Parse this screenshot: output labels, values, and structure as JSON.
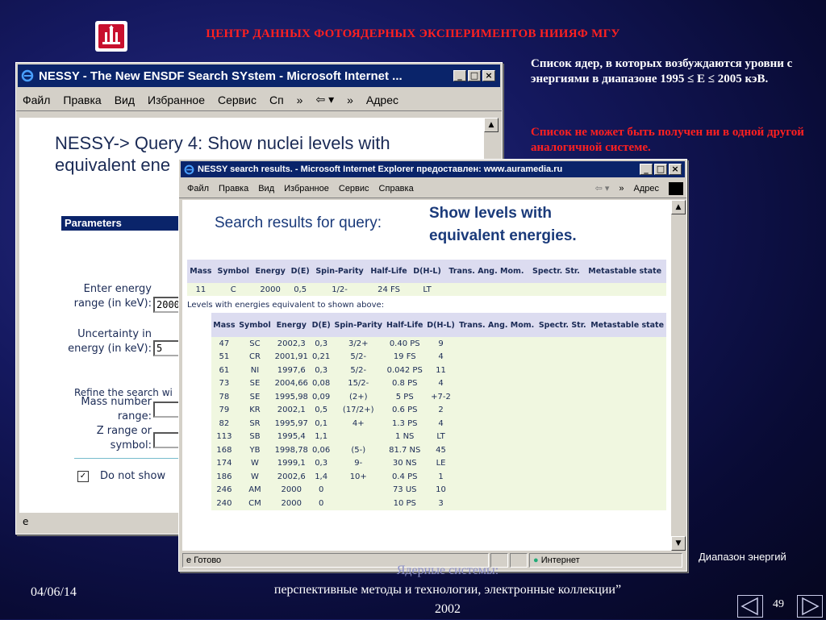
{
  "slide": {
    "title": "ЦЕНТР ДАННЫХ ФОТОЯДЕРНЫХ ЭКСПЕРИМЕНТОВ НИИЯФ МГУ",
    "note1": "Список ядер, в которых возбуждаются уровни с энергиями в диапазоне 1995 ≤ E ≤ 2005 кэВ.",
    "note2": "Список не может быть получен ни в одной другой аналогичной системе.",
    "range_label": "Диапазон энергий",
    "footer_date": "04/06/14",
    "footer_line1": "Ядерные системы:",
    "footer_line2": "перспективные методы и технологии, электронные коллекции”",
    "footer_line3": "2002",
    "page_number": "49",
    "accent_color": "#ff2020"
  },
  "win_back": {
    "title": "NESSY - The New ENSDF Search SYstem - Microsoft Internet ...",
    "menu": [
      "Файл",
      "Правка",
      "Вид",
      "Избранное",
      "Сервис",
      "Сп"
    ],
    "address_label": "Адрес",
    "query_title": "NESSY-> Query 4: Show nuclei levels with equivalent ene",
    "params_header": "Parameters",
    "energy_label": "Enter energy range (in keV):",
    "energy_value": "2000",
    "uncert_label": "Uncertainty in energy (in keV):",
    "uncert_value": "5",
    "refine_label": "Refine the search wi",
    "mass_label": "Mass number range:",
    "z_label": "Z range or symbol:",
    "checkbox_label": "Do not show"
  },
  "win_front": {
    "title": "NESSY search results. - Microsoft Internet Explorer предоставлен: www.auramedia.ru",
    "menu": [
      "Файл",
      "Правка",
      "Вид",
      "Избранное",
      "Сервис",
      "Справка"
    ],
    "address_label": "Адрес",
    "results_title": "Search results for query:",
    "query_line1": "Show levels with",
    "query_line2": "equivalent energies.",
    "levels_note": "Levels with energies equivalent to shown above:",
    "status_left": "Готово",
    "status_zone": "Интернет"
  },
  "table1": {
    "headers": [
      "Mass",
      "Symbol",
      "Energy",
      "D(E)",
      "Spin-Parity",
      "Half-Life",
      "D(H-L)",
      "Trans. Ang. Mom.",
      "Spectr. Str.",
      "Metastable state"
    ],
    "row": [
      "11",
      "C",
      "2000",
      "0,5",
      "1/2-",
      "24 FS",
      "LT",
      "",
      "",
      ""
    ]
  },
  "table2": {
    "headers": [
      "Mass",
      "Symbol",
      "Energy",
      "D(E)",
      "Spin-Parity",
      "Half-Life",
      "D(H-L)",
      "Trans. Ang. Mom.",
      "Spectr. Str.",
      "Metastable state"
    ],
    "rows": [
      [
        "47",
        "SC",
        "2002,3",
        "0,3",
        "3/2+",
        "0.40 PS",
        "9"
      ],
      [
        "51",
        "CR",
        "2001,91",
        "0,21",
        "5/2-",
        "19 FS",
        "4"
      ],
      [
        "61",
        "NI",
        "1997,6",
        "0,3",
        "5/2-",
        "0.042 PS",
        "11"
      ],
      [
        "73",
        "SE",
        "2004,66",
        "0,08",
        "15/2-",
        "0.8 PS",
        "4"
      ],
      [
        "78",
        "SE",
        "1995,98",
        "0,09",
        "(2+)",
        "5 PS",
        "+7-2"
      ],
      [
        "79",
        "KR",
        "2002,1",
        "0,5",
        "(17/2+)",
        "0.6 PS",
        "2"
      ],
      [
        "82",
        "SR",
        "1995,97",
        "0,1",
        "4+",
        "1.3 PS",
        "4"
      ],
      [
        "113",
        "SB",
        "1995,4",
        "1,1",
        "",
        "1 NS",
        "LT"
      ],
      [
        "168",
        "YB",
        "1998,78",
        "0,06",
        "(5-)",
        "81.7 NS",
        "45"
      ],
      [
        "174",
        "W",
        "1999,1",
        "0,3",
        "9-",
        "30 NS",
        "LE"
      ],
      [
        "186",
        "W",
        "2002,6",
        "1,4",
        "10+",
        "0.4 PS",
        "1"
      ],
      [
        "246",
        "AM",
        "2000",
        "0",
        "",
        "73 US",
        "10"
      ],
      [
        "240",
        "CM",
        "2000",
        "0",
        "",
        "10 PS",
        "3"
      ]
    ]
  }
}
